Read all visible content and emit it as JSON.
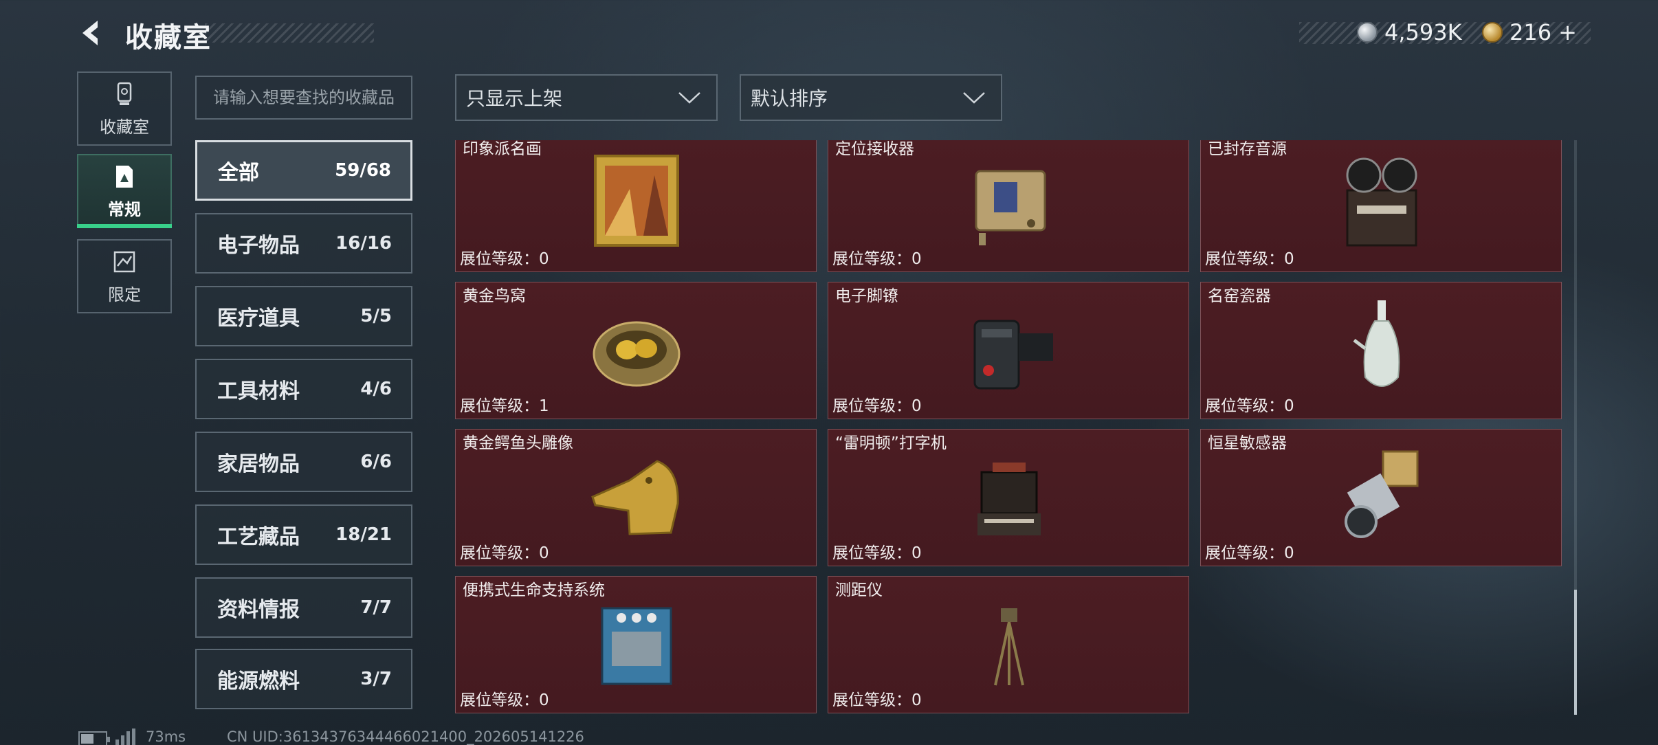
{
  "header": {
    "title": "收藏室",
    "currency_1": {
      "icon": "silver-coin-icon",
      "value": "4,593K"
    },
    "currency_2": {
      "icon": "gold-coin-icon",
      "value": "216",
      "add_label": "+"
    }
  },
  "side_nav": [
    {
      "label": "收藏室",
      "icon": "trophy-icon",
      "active": false
    },
    {
      "label": "常规",
      "icon": "collection-icon",
      "active": true
    },
    {
      "label": "限定",
      "icon": "limited-icon",
      "active": false
    }
  ],
  "search": {
    "placeholder": "请输入想要查找的收藏品"
  },
  "filters": {
    "display_filter": "只显示上架",
    "sort": "默认排序"
  },
  "categories": [
    {
      "label": "全部",
      "count": "59/68",
      "active": true
    },
    {
      "label": "电子物品",
      "count": "16/16",
      "active": false
    },
    {
      "label": "医疗道具",
      "count": "5/5",
      "active": false
    },
    {
      "label": "工具材料",
      "count": "4/6",
      "active": false
    },
    {
      "label": "家居物品",
      "count": "6/6",
      "active": false
    },
    {
      "label": "工艺藏品",
      "count": "18/21",
      "active": false
    },
    {
      "label": "资料情报",
      "count": "7/7",
      "active": false
    },
    {
      "label": "能源燃料",
      "count": "3/7",
      "active": false
    }
  ],
  "items": [
    {
      "name": "印象派名画",
      "level": "展位等级：0",
      "icon": "painting-icon"
    },
    {
      "name": "定位接收器",
      "level": "展位等级：0",
      "icon": "receiver-icon"
    },
    {
      "name": "已封存音源",
      "level": "展位等级：0",
      "icon": "tape-recorder-icon"
    },
    {
      "name": "黄金鸟窝",
      "level": "展位等级：1",
      "icon": "golden-nest-icon"
    },
    {
      "name": "电子脚镣",
      "level": "展位等级：0",
      "icon": "ankle-monitor-icon"
    },
    {
      "name": "名窑瓷器",
      "level": "展位等级：0",
      "icon": "porcelain-vase-icon"
    },
    {
      "name": "黄金鳄鱼头雕像",
      "level": "展位等级：0",
      "icon": "crocodile-statue-icon"
    },
    {
      "name": "“雷明顿”打字机",
      "level": "展位等级：0",
      "icon": "typewriter-icon"
    },
    {
      "name": "恒星敏感器",
      "level": "展位等级：0",
      "icon": "star-sensor-icon"
    },
    {
      "name": "便携式生命支持系统",
      "level": "展位等级：0",
      "icon": "life-support-icon"
    },
    {
      "name": "测距仪",
      "level": "展位等级：0",
      "icon": "rangefinder-icon"
    }
  ],
  "footer": {
    "ping": "73ms",
    "uid": "CN UID:361343763444660214​00_202605141226"
  }
}
